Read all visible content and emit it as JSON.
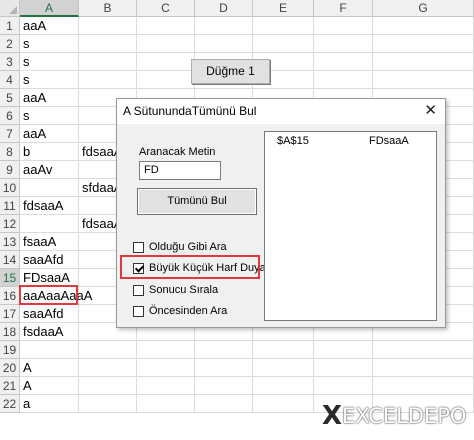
{
  "sheet": {
    "columns": [
      "A",
      "B",
      "C",
      "D",
      "E",
      "F",
      "G"
    ],
    "selected_column": "A",
    "rows": [
      "1",
      "2",
      "3",
      "4",
      "5",
      "6",
      "7",
      "8",
      "9",
      "10",
      "11",
      "12",
      "13",
      "14",
      "15",
      "16",
      "17",
      "18",
      "19",
      "20",
      "21",
      "22"
    ],
    "selected_row": "15",
    "cells": [
      {
        "row": 1,
        "col": "A",
        "text": "aaA"
      },
      {
        "row": 2,
        "col": "A",
        "text": "s"
      },
      {
        "row": 3,
        "col": "A",
        "text": "s"
      },
      {
        "row": 4,
        "col": "A",
        "text": "s"
      },
      {
        "row": 5,
        "col": "A",
        "text": "aaA"
      },
      {
        "row": 6,
        "col": "A",
        "text": "s"
      },
      {
        "row": 7,
        "col": "A",
        "text": "aaA"
      },
      {
        "row": 8,
        "col": "A",
        "text": "b"
      },
      {
        "row": 8,
        "col": "B",
        "text": "fdsaaA"
      },
      {
        "row": 9,
        "col": "A",
        "text": "aaAv"
      },
      {
        "row": 10,
        "col": "B",
        "text": "sfdaaA"
      },
      {
        "row": 11,
        "col": "A",
        "text": "fdsaaA"
      },
      {
        "row": 12,
        "col": "B",
        "text": "fdsaaA"
      },
      {
        "row": 13,
        "col": "A",
        "text": "fsaaA"
      },
      {
        "row": 14,
        "col": "A",
        "text": "saaAfd"
      },
      {
        "row": 15,
        "col": "A",
        "text": "FDsaaA"
      },
      {
        "row": 16,
        "col": "A",
        "text": "aaAaaAaaA"
      },
      {
        "row": 17,
        "col": "A",
        "text": "saaAfd"
      },
      {
        "row": 18,
        "col": "A",
        "text": "fsdaaA"
      },
      {
        "row": 20,
        "col": "A",
        "text": "A"
      },
      {
        "row": 21,
        "col": "A",
        "text": "A"
      },
      {
        "row": 22,
        "col": "A",
        "text": "a"
      }
    ],
    "highlighted_cell": "A15",
    "macro_button_label": "Düğme 1"
  },
  "dialog": {
    "title": "A SütunundaTümünü Bul",
    "close_glyph": "✕",
    "search_label": "Aranacak Metin",
    "search_value": "FD",
    "find_all_button": "Tümünü Bul",
    "options": [
      {
        "label": "Olduğu Gibi Ara",
        "checked": false
      },
      {
        "label": "Büyük Küçük Harf Duyarlı",
        "checked": true
      },
      {
        "label": "Sonucu Sırala",
        "checked": false
      },
      {
        "label": "Öncesinden Ara",
        "checked": false
      }
    ],
    "highlighted_option": "Büyük Küçük Harf Duyarlı",
    "results": [
      {
        "address": "$A$15",
        "value": "FDsaaA"
      }
    ]
  },
  "watermark": {
    "mark": "X",
    "text": "EXCELDEPO"
  },
  "colors": {
    "highlight_red": "#e0393e",
    "excel_green": "#217346"
  }
}
